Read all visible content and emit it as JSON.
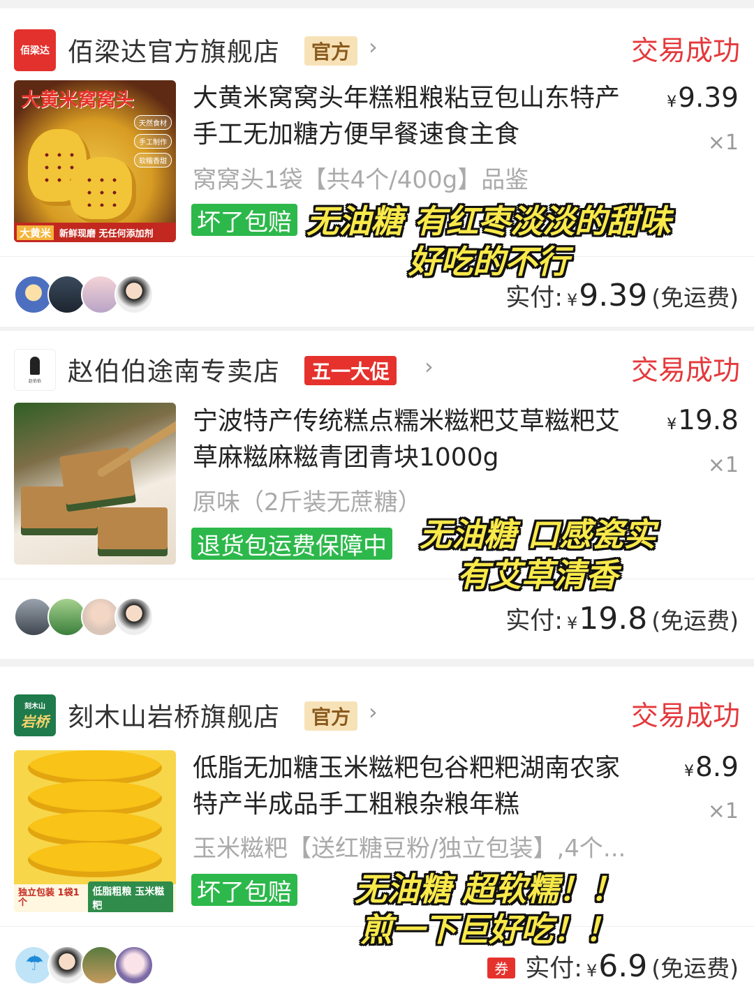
{
  "orders": [
    {
      "store": {
        "logo_text": "佰梁达",
        "name": "佰梁达官方旗舰店",
        "badge": "官方",
        "chevron": "›"
      },
      "status": "交易成功",
      "product": {
        "image_title": "大黄米窝窝头",
        "image_tags": [
          "天然食材",
          "手工制作",
          "软糯香甜"
        ],
        "image_footer_tag": "大黄米",
        "image_footer_text": "新鲜现磨 无任何添加剂",
        "title": "大黄米窝窝头年糕粗粮粘豆包山东特产手工无加糖方便早餐速食主食",
        "price_symbol": "¥",
        "price": "9.39",
        "quantity": "×1",
        "sku": "窝窝头1袋【共4个/400g】品鉴",
        "service_tag": "坏了包赔"
      },
      "payment": {
        "label": "实付:",
        "currency": "¥",
        "amount": "9.39",
        "shipping": "(免运费)"
      },
      "overlay_line1": "无油糖 有红枣淡淡的甜味",
      "overlay_line2": "好吃的不行"
    },
    {
      "store": {
        "logo_text": "赵伯伯",
        "name": "赵伯伯途南专卖店",
        "badge": "五一大促",
        "chevron": "›"
      },
      "status": "交易成功",
      "product": {
        "title": "宁波特产传统糕点糯米糍粑艾草糍粑艾草麻糍麻糍青团青块1000g",
        "price_symbol": "¥",
        "price": "19.8",
        "quantity": "×1",
        "sku": "原味（2斤装无蔗糖）",
        "service_tag": "退货包运费保障中"
      },
      "payment": {
        "label": "实付:",
        "currency": "¥",
        "amount": "19.8",
        "shipping": "(免运费)"
      },
      "overlay_line1": "无油糖 口感瓷实",
      "overlay_line2": "有艾草清香"
    },
    {
      "store": {
        "logo_text_top": "刻木山",
        "logo_text_main": "岩桥",
        "name": "刻木山岩桥旗舰店",
        "badge": "官方",
        "chevron": "›"
      },
      "status": "交易成功",
      "product": {
        "image_footer_left": "独立包装 1袋1个",
        "image_footer_right": "低脂粗粮 玉米糍粑",
        "title": "低脂无加糖玉米糍粑包谷粑粑湖南农家特产半成品手工粗粮杂粮年糕",
        "price_symbol": "¥",
        "price": "8.9",
        "quantity": "×1",
        "sku": "玉米糍粑【送红糖豆粉/独立包装】,4个...",
        "service_tag": "坏了包赔"
      },
      "payment": {
        "coupon": "券",
        "label": "实付:",
        "currency": "¥",
        "amount": "6.9",
        "shipping": "(免运费)"
      },
      "overlay_line1": "无油糖 超软糯！！",
      "overlay_line2": "煎一下巨好吃！！"
    }
  ],
  "colors": {
    "status": "#e4393c",
    "service_green": "#2db84b",
    "badge_gold_bg": "#f7e2b8",
    "badge_red": "#e5322d",
    "overlay_text": "#f9e94a"
  },
  "icons": {
    "chevron": "chevron-right-icon",
    "avatar_umbrella": "umbrella-icon"
  }
}
